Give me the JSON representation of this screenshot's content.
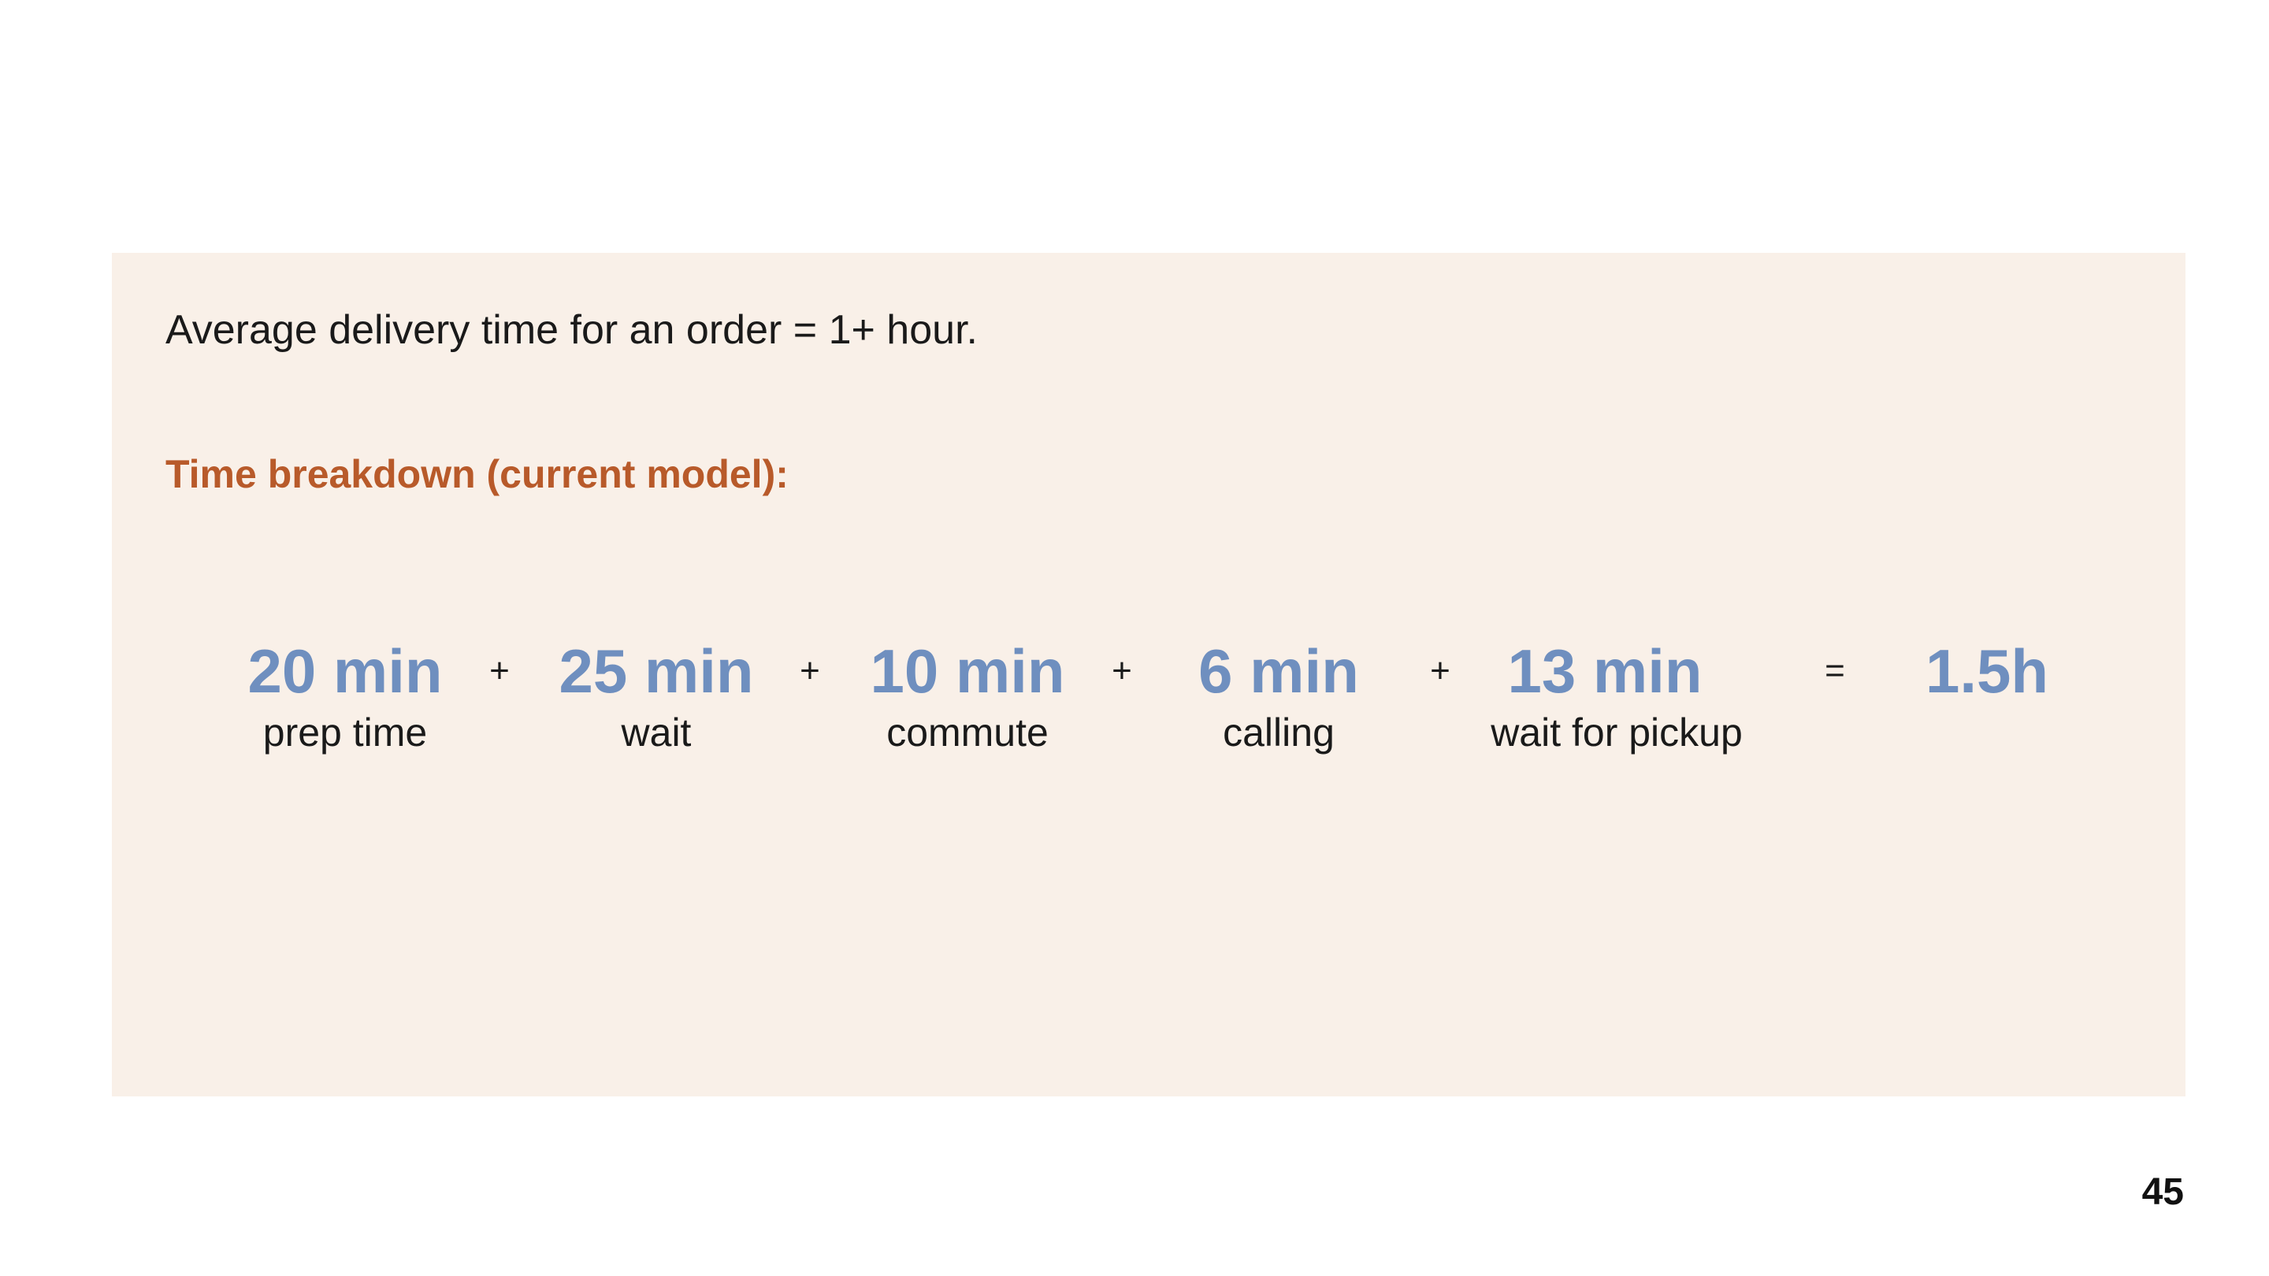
{
  "intro_text": "Average delivery time for an order = 1+ hour.",
  "subheading": "Time breakdown (current model):",
  "terms": [
    {
      "value": "20 min",
      "label": "prep time"
    },
    {
      "value": "25 min",
      "label": "wait"
    },
    {
      "value": "10 min",
      "label": "commute"
    },
    {
      "value": "6 min",
      "label": "calling"
    },
    {
      "value": "13 min",
      "label": "wait for pickup"
    }
  ],
  "operators": [
    "+",
    "+",
    "+",
    "+",
    "="
  ],
  "total": "1.5h",
  "page_number": "45",
  "colors": {
    "panel_background": "#f9f0e8",
    "subheading": "#b85a2a",
    "value": "#6f8fbf"
  }
}
